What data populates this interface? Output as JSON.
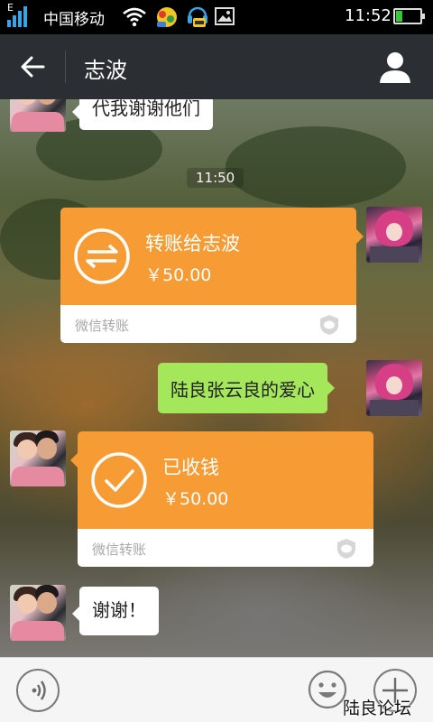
{
  "status_bar": {
    "network_type": "E",
    "carrier": "中国移动",
    "time": "11:52",
    "battery_level_percent": 20,
    "icons": [
      "signal-icon",
      "wifi-icon",
      "app-notification-icon",
      "qq-notification-icon",
      "image-notification-icon",
      "battery-icon"
    ]
  },
  "header": {
    "title": "志波",
    "back_icon": "back-arrow-icon",
    "profile_icon": "person-icon",
    "bar_color": "#2b2f33"
  },
  "messages": {
    "partial_top": "代我谢谢他们",
    "timestamp": "11:50",
    "transfer_sent": {
      "title": "转账给志波",
      "amount": "￥50.00",
      "footer": "微信转账",
      "icon": "transfer-arrows-icon"
    },
    "text_sent": "陆良张云良的爱心",
    "transfer_received": {
      "title": "已收钱",
      "amount": "￥50.00",
      "footer": "微信转账",
      "icon": "check-icon"
    },
    "text_received": "谢谢！"
  },
  "input_bar": {
    "voice_icon": "voice-icon",
    "emoji_icon": "emoji-icon",
    "plus_icon": "plus-icon"
  },
  "watermark": "陆良论坛",
  "colors": {
    "transfer_orange": "#f79c35",
    "sent_bubble_green": "#a4e75b",
    "received_bubble_white": "#ffffff"
  }
}
